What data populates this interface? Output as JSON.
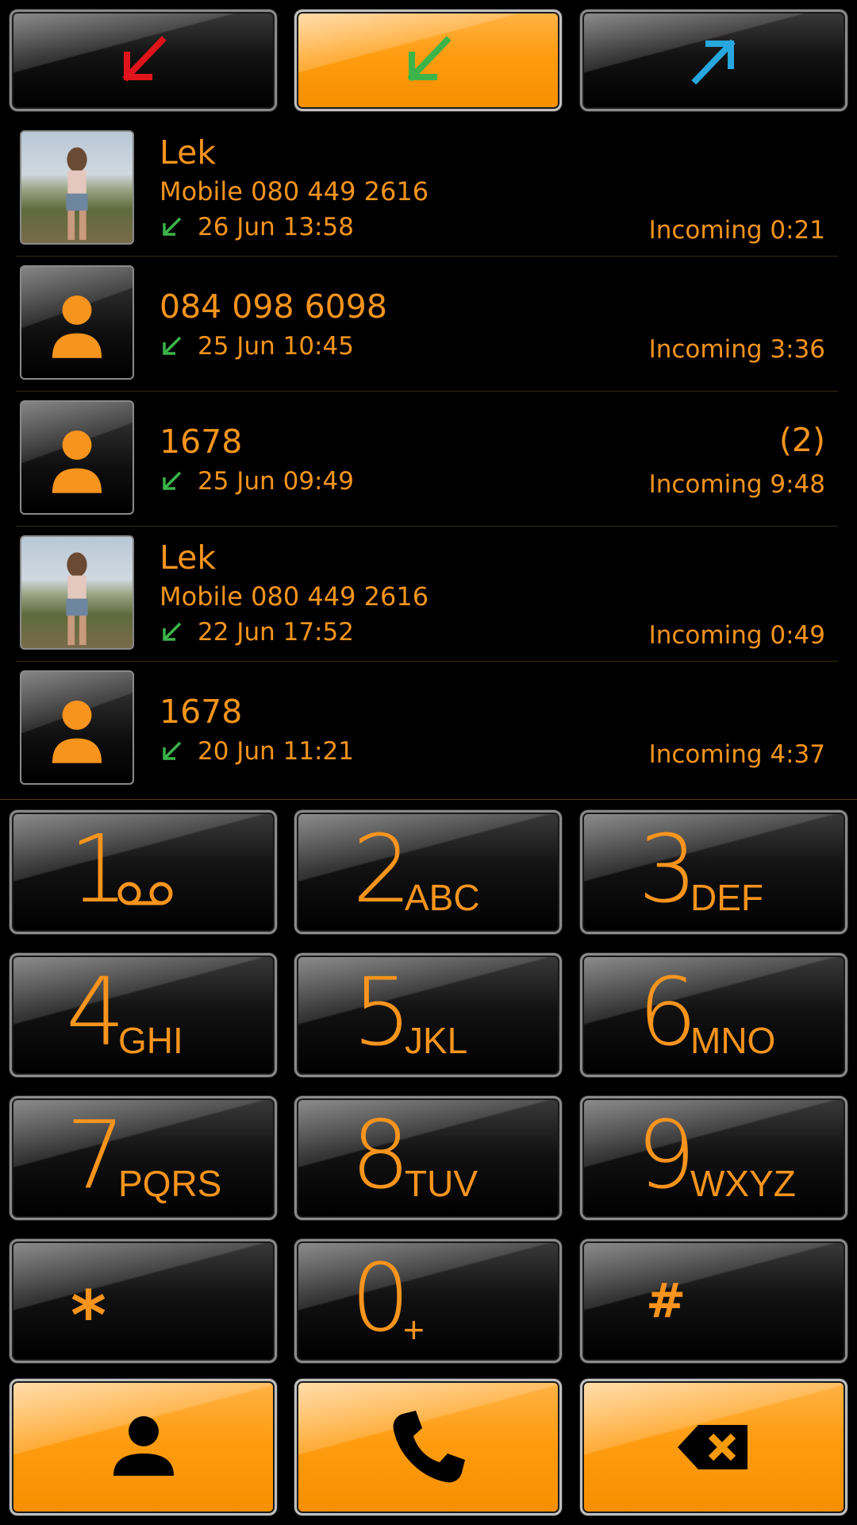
{
  "tabs": [
    {
      "name": "missed",
      "icon": "missed-call-arrow-icon",
      "color": "#e0141b",
      "active": false
    },
    {
      "name": "incoming",
      "icon": "incoming-call-arrow-icon",
      "color": "#3cb44a",
      "active": true
    },
    {
      "name": "outgoing",
      "icon": "outgoing-call-arrow-icon",
      "color": "#27a7de",
      "active": false
    }
  ],
  "calls": [
    {
      "name": "Lek",
      "number": "Mobile 080 449 2616",
      "date": "26 Jun 13:58",
      "status": "Incoming 0:21",
      "count": "",
      "avatar": "photo"
    },
    {
      "name": "084 098 6098",
      "number": "",
      "date": "25 Jun 10:45",
      "status": "Incoming 3:36",
      "count": "",
      "avatar": "generic"
    },
    {
      "name": "1678",
      "number": "",
      "date": "25 Jun 09:49",
      "status": "Incoming 9:48",
      "count": "(2)",
      "avatar": "generic"
    },
    {
      "name": "Lek",
      "number": "Mobile 080 449 2616",
      "date": "22 Jun 17:52",
      "status": "Incoming 0:49",
      "count": "",
      "avatar": "photo"
    },
    {
      "name": "1678",
      "number": "",
      "date": "20 Jun 11:21",
      "status": "Incoming 4:37",
      "count": "",
      "avatar": "generic"
    }
  ],
  "keypad": [
    {
      "digit": "1",
      "letters": "",
      "icon": "voicemail-icon"
    },
    {
      "digit": "2",
      "letters": "ABC"
    },
    {
      "digit": "3",
      "letters": "DEF"
    },
    {
      "digit": "4",
      "letters": "GHI"
    },
    {
      "digit": "5",
      "letters": "JKL"
    },
    {
      "digit": "6",
      "letters": "MNO"
    },
    {
      "digit": "7",
      "letters": "PQRS"
    },
    {
      "digit": "8",
      "letters": "TUV"
    },
    {
      "digit": "9",
      "letters": "WXYZ"
    },
    {
      "digit": "*",
      "letters": ""
    },
    {
      "digit": "0",
      "letters": "+"
    },
    {
      "digit": "#",
      "letters": ""
    }
  ],
  "actions": [
    {
      "name": "contacts",
      "icon": "person-icon"
    },
    {
      "name": "call",
      "icon": "phone-handset-icon"
    },
    {
      "name": "delete",
      "icon": "backspace-icon"
    }
  ],
  "colors": {
    "accent": "#f7941d",
    "incoming_arrow": "#3cb44a",
    "background": "#000000"
  }
}
